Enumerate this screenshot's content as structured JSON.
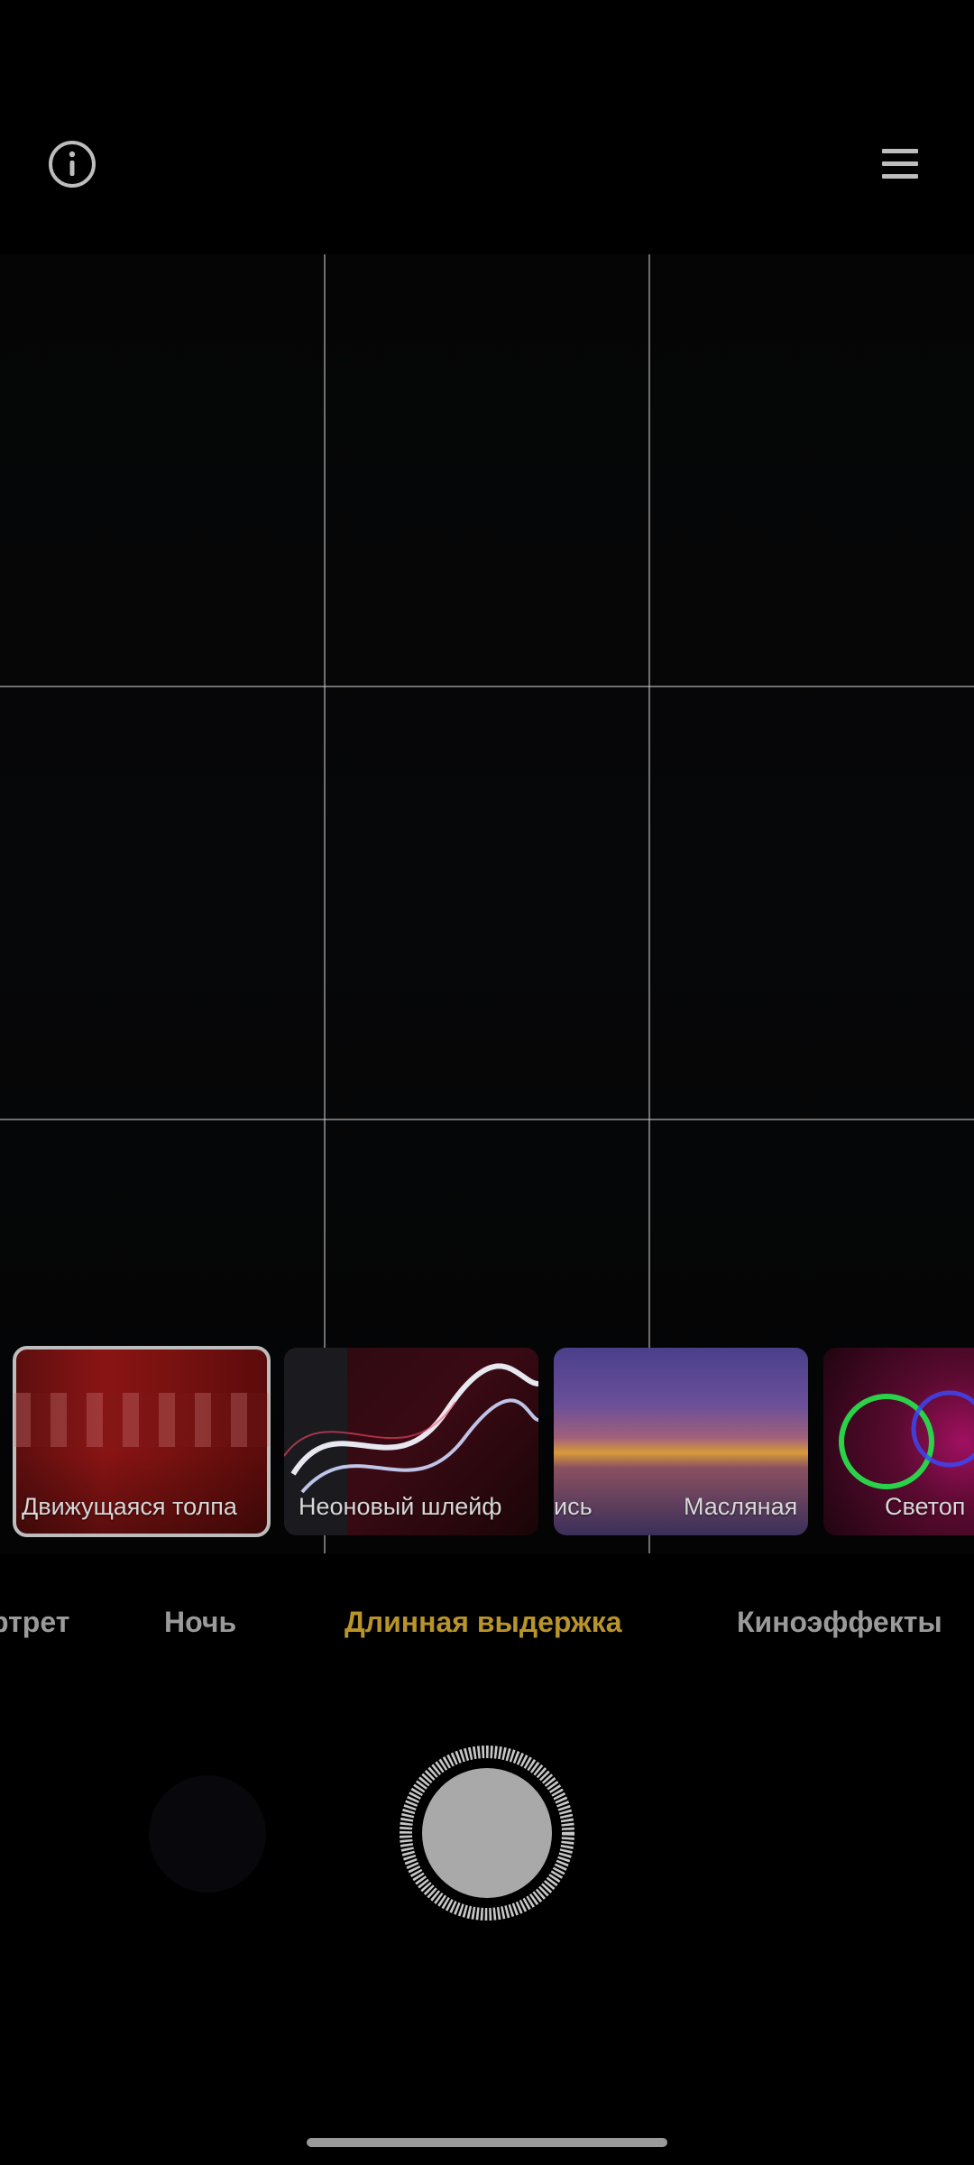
{
  "top_bar": {
    "info_icon": "info-icon",
    "menu_icon": "menu-icon"
  },
  "effects": [
    {
      "label": "Движущаяся толпа",
      "selected": true
    },
    {
      "label": "Неоновый шлейф",
      "selected": false
    },
    {
      "label_left": "ись",
      "label": "Масляная",
      "selected": false
    },
    {
      "label": "Светоп",
      "selected": false
    }
  ],
  "modes": [
    {
      "label": "ртрет"
    },
    {
      "label": "Ночь"
    },
    {
      "label": "Длинная выдержка",
      "active": true
    },
    {
      "label": "Киноэффекты"
    }
  ],
  "colors": {
    "active_mode": "#b8942a",
    "inactive_mode": "#9a9a9a",
    "background": "#000000"
  }
}
